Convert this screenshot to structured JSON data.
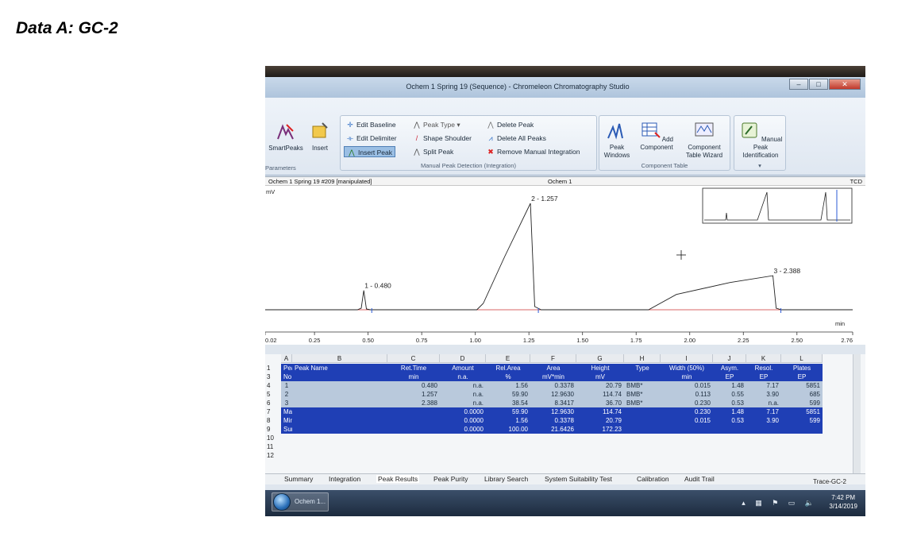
{
  "heading": "Data A: GC-2",
  "window": {
    "title": "Ochem 1 Spring 19 (Sequence) - Chromeleon Chromatography Studio",
    "help": "?"
  },
  "ribbon": {
    "smartpeaks": "SmartPeaks",
    "insert": "Insert",
    "parameters": "Parameters",
    "edit_baseline": "Edit Baseline",
    "edit_delimiter": "Edit Delimiter",
    "insert_peak": "Insert Peak",
    "peak_type": "Peak Type",
    "shape_shoulder": "Shape Shoulder",
    "split_peak": "Split Peak",
    "delete_peak": "Delete Peak",
    "delete_all_peaks": "Delete All Peaks",
    "remove_manual": "Remove Manual Integration",
    "manual_group": "Manual Peak Detection (Integration)",
    "peak_windows_1": "Peak",
    "peak_windows_2": "Windows",
    "add_component_1": "Add",
    "add_component_2": "Component",
    "component_wizard_1": "Component",
    "component_wizard_2": "Table Wizard",
    "component_group": "Component Table",
    "manual_id_1": "Manual Peak",
    "manual_id_2": "Identification"
  },
  "chart": {
    "pane_title": "Ochem 1 Spring 19 #209 [manipulated]",
    "center_title": "Ochem 1",
    "detector": "TCD",
    "y_unit": "mV",
    "x_unit": "min"
  },
  "chart_data": {
    "type": "line",
    "title": "Ochem 1",
    "xlabel": "min",
    "ylabel": "mV",
    "xlim": [
      0.02,
      2.76
    ],
    "x_ticks": [
      "0.02",
      "0.25",
      "0.50",
      "0.75",
      "1.00",
      "1.25",
      "1.50",
      "1.75",
      "2.00",
      "2.25",
      "2.50",
      "2.76"
    ],
    "peaks": [
      {
        "label": "1 - 0.480",
        "rt": 0.48,
        "height": 20.79
      },
      {
        "label": "2 - 1.257",
        "rt": 1.257,
        "height": 114.74
      },
      {
        "label": "3 - 2.388",
        "rt": 2.388,
        "height": 36.7
      }
    ]
  },
  "table": {
    "col_letters": [
      "A",
      "B",
      "C",
      "D",
      "E",
      "F",
      "G",
      "H",
      "I",
      "J",
      "K",
      "L"
    ],
    "headers_top": [
      "Peak",
      "Peak Name",
      "Ret.Time",
      "Amount",
      "Rel.Area",
      "Area",
      "Height",
      "Type",
      "Width (50%)",
      "Asym.",
      "Resol.",
      "Plates"
    ],
    "headers_bottom": [
      "No.",
      "",
      "min",
      "n.a.",
      "%",
      "mV*min",
      "mV",
      "",
      "min",
      "EP",
      "EP",
      "EP"
    ],
    "row_numbers": [
      "1",
      "3",
      "4",
      "5",
      "6",
      "7",
      "8",
      "9",
      "10",
      "11",
      "12"
    ],
    "rows": [
      [
        "1",
        "",
        "0.480",
        "n.a.",
        "1.56",
        "0.3378",
        "20.79",
        "BMB*",
        "0.015",
        "1.48",
        "7.17",
        "5851"
      ],
      [
        "2",
        "",
        "1.257",
        "n.a.",
        "59.90",
        "12.9630",
        "114.74",
        "BMB*",
        "0.113",
        "0.55",
        "3.90",
        "685"
      ],
      [
        "3",
        "",
        "2.388",
        "n.a.",
        "38.54",
        "8.3417",
        "36.70",
        "BMB*",
        "0.230",
        "0.53",
        "n.a.",
        "599"
      ]
    ],
    "summary": [
      [
        "Maximum",
        "",
        "",
        "0.0000",
        "59.90",
        "12.9630",
        "114.74",
        "",
        "0.230",
        "1.48",
        "7.17",
        "5851"
      ],
      [
        "Minimum",
        "",
        "",
        "0.0000",
        "1.56",
        "0.3378",
        "20.79",
        "",
        "0.015",
        "0.53",
        "3.90",
        "599"
      ],
      [
        "Sum",
        "",
        "",
        "0.0000",
        "100.00",
        "21.6426",
        "172.23",
        "",
        "",
        "",
        "",
        ""
      ]
    ]
  },
  "tabs": [
    "Summary",
    "Integration",
    "Peak Results",
    "Peak Purity",
    "Library Search",
    "System Suitability Test",
    "Calibration",
    "Audit Trail"
  ],
  "status": {
    "trace": "Trace-GC-2",
    "task": "Ochem 1...",
    "time": "7:42 PM",
    "date": "3/14/2019"
  }
}
